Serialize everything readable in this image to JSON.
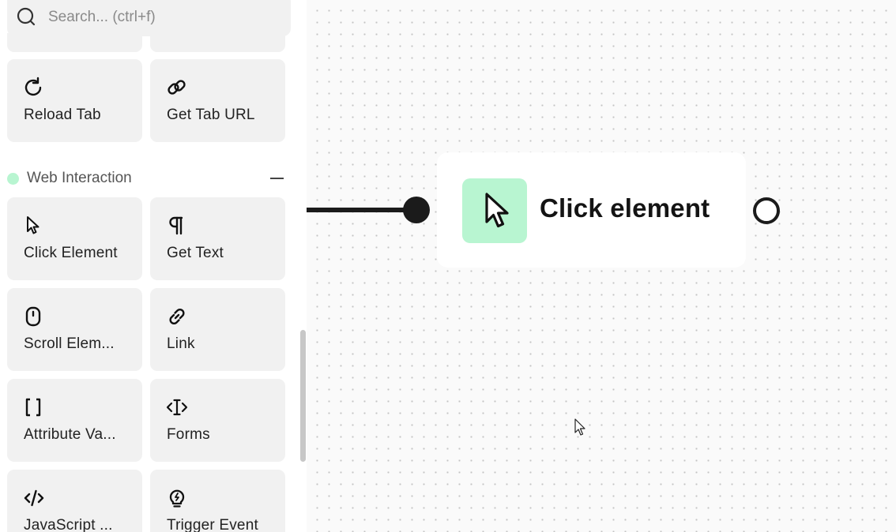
{
  "search": {
    "placeholder": "Search... (ctrl+f)"
  },
  "sidebar": {
    "browser_cards": [
      {
        "label": "Reload Tab",
        "icon": "reload-icon"
      },
      {
        "label": "Get Tab URL",
        "icon": "link-chain-icon"
      }
    ],
    "section": {
      "title": "Web Interaction",
      "dot_color": "#b8f5d1"
    },
    "web_cards": [
      {
        "label": "Click Element",
        "icon": "cursor-icon"
      },
      {
        "label": "Get Text",
        "icon": "paragraph-icon"
      },
      {
        "label": "Scroll Elem...",
        "icon": "mouse-icon"
      },
      {
        "label": "Link",
        "icon": "link-icon"
      },
      {
        "label": "Attribute Va...",
        "icon": "brackets-icon"
      },
      {
        "label": "Forms",
        "icon": "text-cursor-icon"
      },
      {
        "label": "JavaScript ...",
        "icon": "code-icon"
      },
      {
        "label": "Trigger Event",
        "icon": "lightbulb-icon"
      }
    ]
  },
  "canvas": {
    "node": {
      "title": "Click element",
      "icon": "cursor-icon",
      "icon_bg": "#b8f5d1"
    }
  }
}
